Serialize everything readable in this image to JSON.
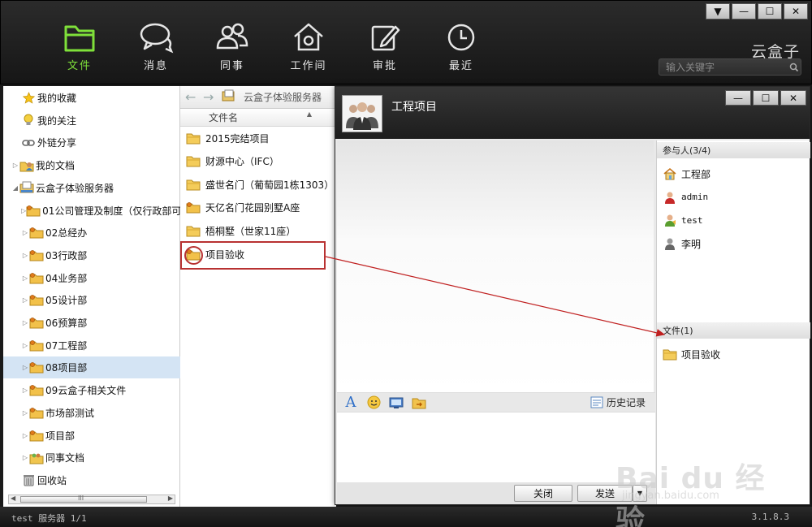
{
  "window_controls": {
    "menu": "▼",
    "minimize": "—",
    "maximize": "☐",
    "close": "✕"
  },
  "nav": [
    {
      "label": "文件",
      "icon": "folder-icon",
      "active": true
    },
    {
      "label": "消息",
      "icon": "chat-bubbles-icon",
      "active": false
    },
    {
      "label": "同事",
      "icon": "colleagues-icon",
      "active": false
    },
    {
      "label": "工作间",
      "icon": "workspace-house-icon",
      "active": false
    },
    {
      "label": "审批",
      "icon": "approval-pen-icon",
      "active": false
    },
    {
      "label": "最近",
      "icon": "clock-icon",
      "active": false
    }
  ],
  "brand": "云盒子",
  "search": {
    "placeholder": "输入关键字"
  },
  "sidebar": {
    "items": [
      {
        "label": "我的收藏",
        "icon": "star-icon",
        "arrow": ""
      },
      {
        "label": "我的关注",
        "icon": "lightbulb-icon",
        "arrow": ""
      },
      {
        "label": "外链分享",
        "icon": "link-icon",
        "arrow": ""
      },
      {
        "label": "我的文档",
        "icon": "my-docs-icon",
        "arrow": "▷"
      },
      {
        "label": "云盒子体验服务器",
        "icon": "server-icon",
        "arrow": "◢"
      },
      {
        "label": "01公司管理及制度（仅行政部可",
        "icon": "shared-folder-icon",
        "arrow": "▷"
      },
      {
        "label": "02总经办",
        "icon": "shared-folder-icon",
        "arrow": "▷"
      },
      {
        "label": "03行政部",
        "icon": "shared-folder-icon",
        "arrow": "▷"
      },
      {
        "label": "04业务部",
        "icon": "shared-folder-icon",
        "arrow": "▷"
      },
      {
        "label": "05设计部",
        "icon": "shared-folder-icon",
        "arrow": "▷"
      },
      {
        "label": "06预算部",
        "icon": "shared-folder-icon",
        "arrow": "▷"
      },
      {
        "label": "07工程部",
        "icon": "shared-folder-icon",
        "arrow": "▷"
      },
      {
        "label": "08项目部",
        "icon": "shared-folder-icon",
        "arrow": "▷",
        "selected": true
      },
      {
        "label": "09云盒子相关文件",
        "icon": "shared-folder-icon",
        "arrow": "▷"
      },
      {
        "label": "市场部测试",
        "icon": "shared-folder-icon",
        "arrow": "▷"
      },
      {
        "label": "项目部",
        "icon": "shared-folder-icon",
        "arrow": "▷"
      },
      {
        "label": "同事文档",
        "icon": "colleague-docs-icon",
        "arrow": "▷"
      },
      {
        "label": "回收站",
        "icon": "trash-icon",
        "arrow": ""
      }
    ],
    "scroll_grip": "III",
    "scroll_left": "◀",
    "scroll_right": "▶"
  },
  "filepane": {
    "back": "←",
    "forward": "→",
    "breadcrumb": "云盒子体验服务器",
    "column_header": "文件名",
    "files": [
      {
        "name": "2015完结项目",
        "icon": "folder-icon"
      },
      {
        "name": "财源中心（IFC）",
        "icon": "folder-icon"
      },
      {
        "name": "盛世名门（葡萄园1栋1303）",
        "icon": "folder-icon"
      },
      {
        "name": "天亿名门花园别墅A座",
        "icon": "shared-folder-icon"
      },
      {
        "name": "梧桐墅（世家11座）",
        "icon": "folder-icon"
      },
      {
        "name": "项目验收",
        "icon": "shared-folder-icon"
      }
    ]
  },
  "chat": {
    "title": "工程项目",
    "controls": {
      "minimize": "—",
      "maximize": "☐",
      "close": "✕"
    },
    "participants_header": "参与人(3/4)",
    "participants": [
      {
        "name": "工程部",
        "icon": "department-house-icon"
      },
      {
        "name": "admin",
        "icon": "user-red-icon"
      },
      {
        "name": "test",
        "icon": "user-green-icon"
      },
      {
        "name": "李明",
        "icon": "user-gray-icon"
      }
    ],
    "files_header": "文件(1)",
    "files": [
      {
        "name": "项目验收",
        "icon": "folder-icon"
      }
    ],
    "history_label": "历史记录",
    "close_button": "关闭",
    "send_button": "发送",
    "send_dropdown": "▼",
    "font_glyph": "A"
  },
  "status": {
    "left": "test  服务器 1/1",
    "version": "3.1.8.3"
  },
  "watermark": {
    "main": "Bai du 经验",
    "sub": "jingyan.baidu.com"
  }
}
